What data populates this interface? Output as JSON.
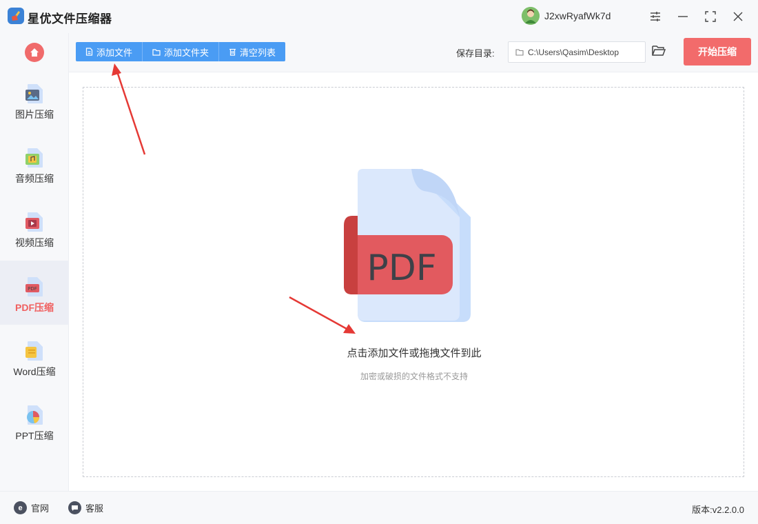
{
  "app": {
    "title": "星优文件压缩器",
    "logo_icon": "broom-icon"
  },
  "user": {
    "name": "J2xwRyafWk7d"
  },
  "window_controls": [
    "settings-icon",
    "minimize-icon",
    "maximize-icon",
    "close-icon"
  ],
  "sidebar": {
    "items": [
      {
        "label": "图片压缩",
        "icon": "image-file-icon",
        "active": false
      },
      {
        "label": "音频压缩",
        "icon": "audio-file-icon",
        "active": false
      },
      {
        "label": "视频压缩",
        "icon": "video-file-icon",
        "active": false
      },
      {
        "label": "PDF压缩",
        "icon": "pdf-file-icon",
        "active": true
      },
      {
        "label": "Word压缩",
        "icon": "word-file-icon",
        "active": false
      },
      {
        "label": "PPT压缩",
        "icon": "ppt-file-icon",
        "active": false
      }
    ]
  },
  "toolbar": {
    "add_file": "添加文件",
    "add_folder": "添加文件夹",
    "clear_list": "清空列表",
    "save_label": "保存目录:",
    "save_path": "C:\\Users\\Qasim\\Desktop",
    "start": "开始压缩"
  },
  "dropzone": {
    "pdf_text": "PDF",
    "title": "点击添加文件或拖拽文件到此",
    "subtitle": "加密或破损的文件格式不支持"
  },
  "footer": {
    "website": "官网",
    "support": "客服",
    "version": "版本:v2.2.0.0"
  },
  "colors": {
    "accent_blue": "#4a9cf4",
    "accent_red": "#f26b6b",
    "annotation_arrow": "#e53935"
  }
}
